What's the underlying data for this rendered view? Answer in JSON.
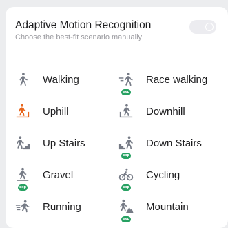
{
  "header": {
    "title": "Adaptive Motion Recognition",
    "subtitle": "Choose the best-fit scenario manually",
    "toggle_on": false
  },
  "colors": {
    "icon_default": "#757a85",
    "icon_highlight": "#e8661c",
    "badge": "#27a162"
  },
  "scenarios": [
    {
      "label": "Walking",
      "icon": "walking-icon",
      "badge": ""
    },
    {
      "label": "Race walking",
      "icon": "race-walking-icon",
      "badge": "exp"
    },
    {
      "label": "Uphill",
      "icon": "uphill-icon",
      "badge": ""
    },
    {
      "label": "Downhill",
      "icon": "downhill-icon",
      "badge": ""
    },
    {
      "label": "Up Stairs",
      "icon": "up-stairs-icon",
      "badge": ""
    },
    {
      "label": "Down Stairs",
      "icon": "down-stairs-icon",
      "badge": "exp"
    },
    {
      "label": "Gravel",
      "icon": "gravel-icon",
      "badge": "exp"
    },
    {
      "label": "Cycling",
      "icon": "cycling-icon",
      "badge": "exp"
    },
    {
      "label": "Running",
      "icon": "running-icon",
      "badge": ""
    },
    {
      "label": "Mountain",
      "icon": "mountain-icon",
      "badge": "exp"
    }
  ]
}
